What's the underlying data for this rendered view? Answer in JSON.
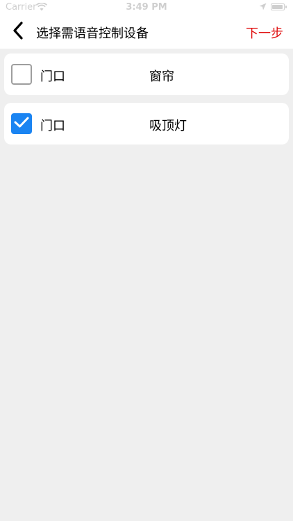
{
  "status_bar": {
    "carrier": "Carrier",
    "time": "3:49 PM",
    "wifi_icon": "wifi-icon",
    "location_icon": "location-arrow-icon",
    "battery_icon": "battery-icon"
  },
  "nav": {
    "back_icon": "chevron-left-icon",
    "title": "选择需语音控制设备",
    "next_label": "下一步",
    "next_color": "#e01010"
  },
  "devices": [
    {
      "room": "门口",
      "device": "窗帘",
      "checked": false
    },
    {
      "room": "门口",
      "device": "吸顶灯",
      "checked": true
    }
  ],
  "colors": {
    "background": "#efefef",
    "checkbox_checked": "#1a84f2",
    "checkbox_unchecked_border": "#9e9e9e"
  }
}
